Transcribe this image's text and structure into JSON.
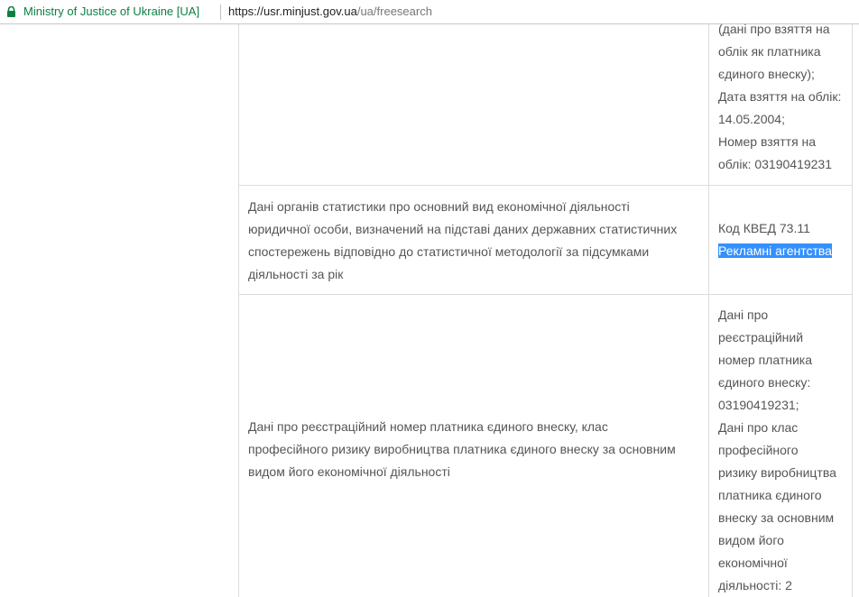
{
  "browser": {
    "site_name": "Ministry of Justice of Ukraine [UA]",
    "url_host": "https://usr.minjust.gov.ua",
    "url_path": "/ua/freesearch"
  },
  "rows": [
    {
      "label": "",
      "value_lines": [
        "(дані про взяття на",
        "облік як платника",
        "єдиного внеску);",
        "Дата взяття на облік:",
        "14.05.2004;",
        "Номер взяття на",
        "облік: 03190419231"
      ]
    },
    {
      "label_lines": [
        "Дані органів статистики про основний вид економічної діяльності",
        "юридичної особи, визначений на підставі даних державних статистичних",
        "спостережень відповідно до статистичної методології за підсумками",
        "діяльності за рік"
      ],
      "value_lines": [
        "Код КВЕД 73.11"
      ],
      "value_highlight": "Рекламні агентства"
    },
    {
      "label_lines": [
        "Дані про реєстраційний номер платника єдиного внеску, клас",
        "професійного ризику виробництва платника єдиного внеску за основним",
        "видом його економічної діяльності"
      ],
      "value_lines": [
        "Дані про",
        "реєстраційний",
        "номер платника",
        "єдиного внеску:",
        "03190419231;",
        "Дані про клас",
        "професійного",
        "ризику виробництва",
        "платника єдиного",
        "внеску за основним",
        "видом його",
        "економічної",
        "діяльності: 2"
      ]
    }
  ]
}
